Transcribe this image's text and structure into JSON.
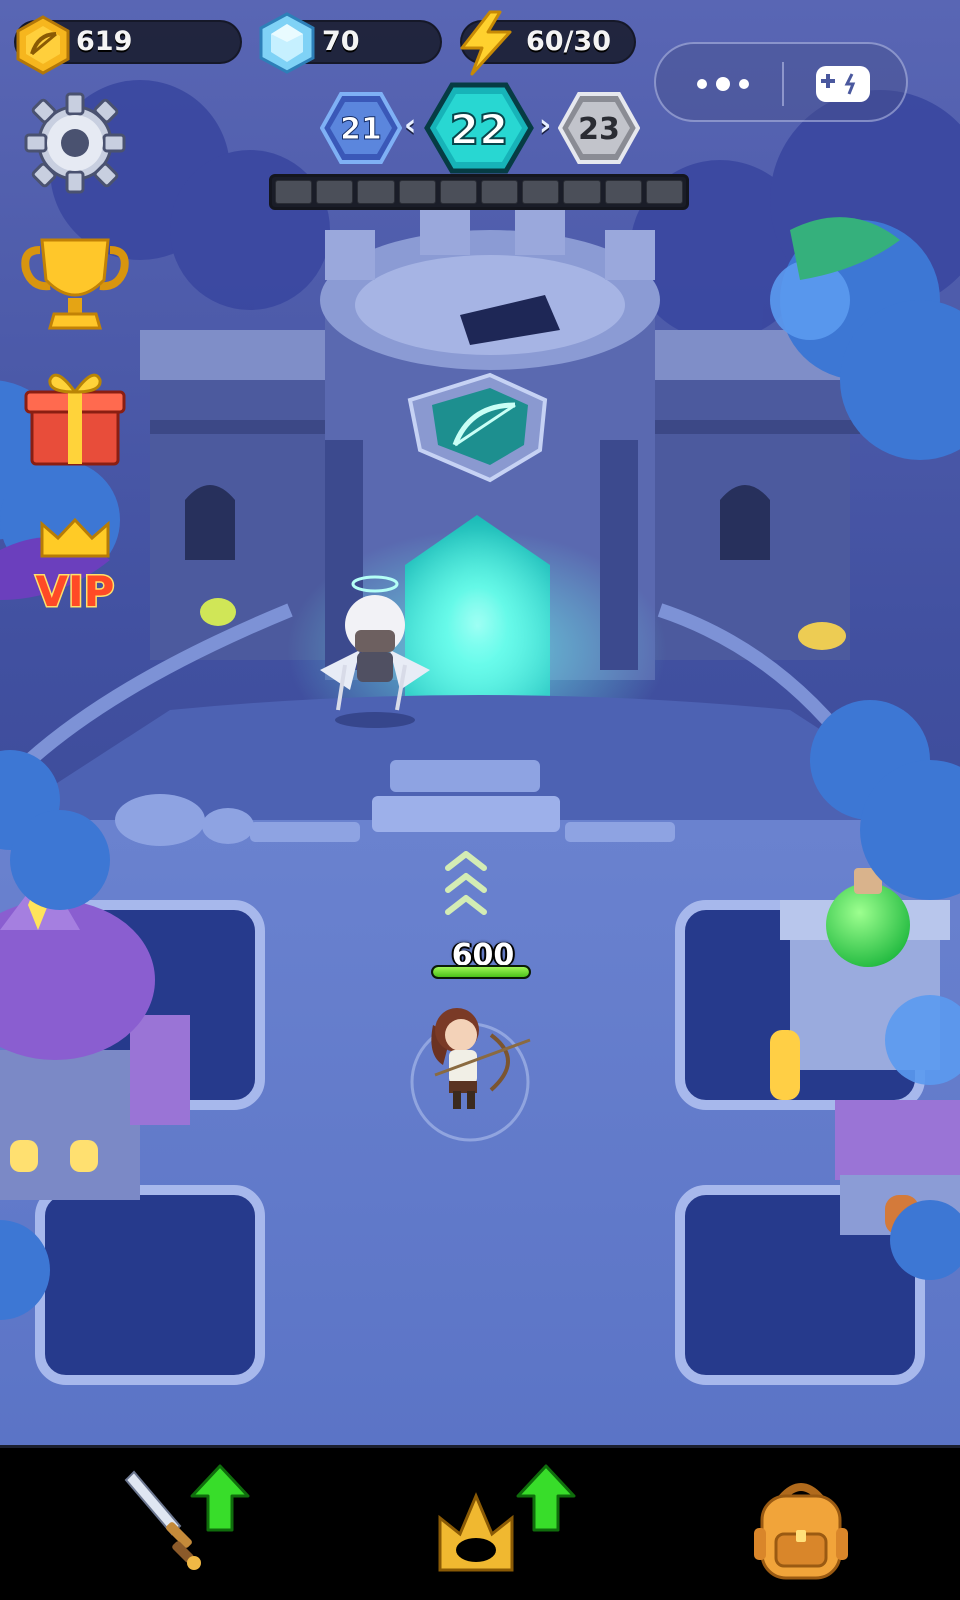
{
  "hud": {
    "gold": {
      "icon": "bow-coin-icon",
      "value": "619"
    },
    "gems": {
      "icon": "diamond-icon",
      "value": "70"
    },
    "energy": {
      "icon": "lightning-icon",
      "value": "60/30"
    }
  },
  "capsule": {
    "more_icon": "more-dots-icon",
    "game_icon": "gamepad-icon"
  },
  "levels": {
    "previous": "21",
    "current": "22",
    "next": "23",
    "wave_segments_total": 10,
    "wave_segments_filled": 0
  },
  "side_menu": [
    {
      "id": "settings",
      "icon": "gear-icon"
    },
    {
      "id": "ranking",
      "icon": "trophy-icon"
    },
    {
      "id": "gift",
      "icon": "gift-icon"
    },
    {
      "id": "vip",
      "icon": "crown-icon",
      "label": "VIP"
    }
  ],
  "player": {
    "hp": "600",
    "hp_fraction": 1.0
  },
  "bottom_bar": [
    {
      "id": "weapon",
      "icon": "sword-icon",
      "upgrade_available": true
    },
    {
      "id": "heroes",
      "icon": "crown-icon",
      "upgrade_available": true
    },
    {
      "id": "backpack",
      "icon": "backpack-icon",
      "upgrade_available": false
    }
  ],
  "colors": {
    "sky": "#4a5aa8",
    "ground": "#7188d4",
    "portal": "#37f0dc",
    "accent_cyan": "#25d8d0",
    "hp_green": "#6bdd2c",
    "arrow_green": "#2fd428"
  }
}
